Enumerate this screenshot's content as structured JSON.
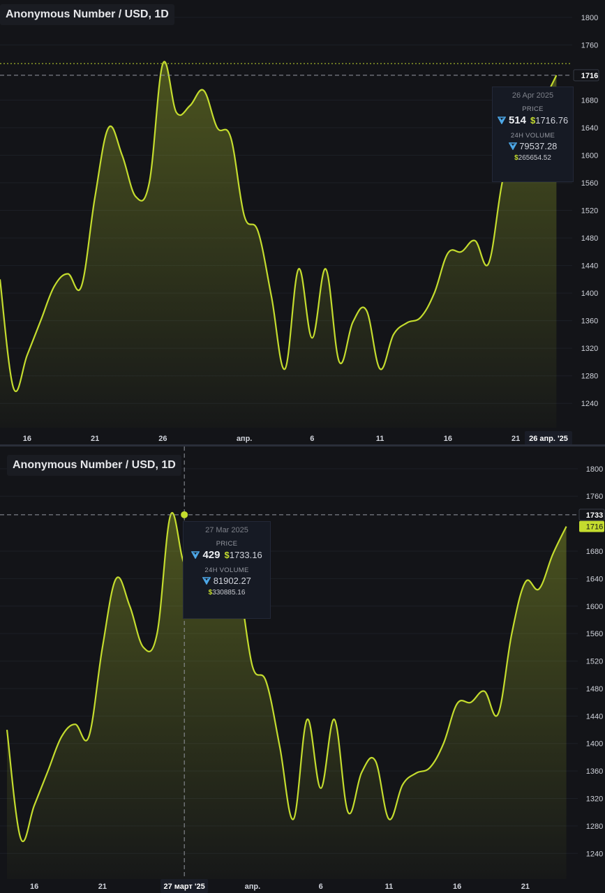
{
  "colors": {
    "background": "#131418",
    "line": "#c4dc2e",
    "grid": "#1c1f26",
    "axis_text": "#d1d4dc",
    "crosshair": "#9598a1",
    "ton": "#4da8e8",
    "price_label_bg": "#c4dc2e"
  },
  "icons": {
    "ton": "ton-diamond-icon"
  },
  "chart_data": [
    {
      "type": "area",
      "title": "Anonymous Number / USD, 1D",
      "x": [
        "Mar 14",
        "Mar 15",
        "Mar 16",
        "Mar 17",
        "Mar 18",
        "Mar 19",
        "Mar 20",
        "Mar 21",
        "Mar 22",
        "Mar 23",
        "Mar 24",
        "Mar 25",
        "Mar 26",
        "Mar 27",
        "Mar 28",
        "Mar 29",
        "Mar 30",
        "Mar 31",
        "Apr 1",
        "Apr 2",
        "Apr 3",
        "Apr 4",
        "Apr 5",
        "Apr 6",
        "Apr 7",
        "Apr 8",
        "Apr 9",
        "Apr 10",
        "Apr 11",
        "Apr 12",
        "Apr 13",
        "Apr 14",
        "Apr 15",
        "Apr 16",
        "Apr 17",
        "Apr 18",
        "Apr 19",
        "Apr 20",
        "Apr 21",
        "Apr 22",
        "Apr 23",
        "Apr 24",
        "Apr 25",
        "Apr 26"
      ],
      "series": [
        {
          "values": [
            1420,
            1262,
            1310,
            1360,
            1410,
            1428,
            1410,
            1540,
            1640,
            1600,
            1540,
            1560,
            1733,
            1662,
            1672,
            1694,
            1640,
            1626,
            1512,
            1490,
            1395,
            1290,
            1435,
            1335,
            1435,
            1300,
            1358,
            1375,
            1290,
            1340,
            1357,
            1365,
            1400,
            1458,
            1460,
            1476,
            1443,
            1560,
            1635,
            1625,
            1675,
            1716
          ]
        }
      ],
      "ylim": [
        1220,
        1810
      ],
      "y_ticks": [
        "1800",
        "1760",
        "1680",
        "1640",
        "1600",
        "1560",
        "1520",
        "1480",
        "1440",
        "1400",
        "1360",
        "1320",
        "1280",
        "1240"
      ],
      "x_ticks": [
        {
          "label": "16",
          "x": "Mar 16"
        },
        {
          "label": "21",
          "x": "Mar 21"
        },
        {
          "label": "26",
          "x": "Mar 26"
        },
        {
          "label": "апр.",
          "x": "Apr 1"
        },
        {
          "label": "6",
          "x": "Apr 6"
        },
        {
          "label": "11",
          "x": "Apr 11"
        },
        {
          "label": "16",
          "x": "Apr 16"
        },
        {
          "label": "21",
          "x": "Apr 21"
        }
      ],
      "crosshair": {
        "x": "Apr 26",
        "y": 1716,
        "y_label": "1716",
        "x_label": "26 апр. '25"
      },
      "last_price_line": 1733,
      "tooltip": {
        "date": "26 Apr 2025",
        "price_label": "PRICE",
        "price_ton": "514",
        "price_usd": "1716.76",
        "volume_label": "24H VOLUME",
        "volume_ton": "79537.28",
        "volume_usd": "265654.52"
      },
      "grid": true
    },
    {
      "type": "area",
      "title": "Anonymous Number / USD, 1D",
      "x": [
        "Mar 14",
        "Mar 15",
        "Mar 16",
        "Mar 17",
        "Mar 18",
        "Mar 19",
        "Mar 20",
        "Mar 21",
        "Mar 22",
        "Mar 23",
        "Mar 24",
        "Mar 25",
        "Mar 26",
        "Mar 27",
        "Mar 28",
        "Mar 29",
        "Mar 30",
        "Mar 31",
        "Apr 1",
        "Apr 2",
        "Apr 3",
        "Apr 4",
        "Apr 5",
        "Apr 6",
        "Apr 7",
        "Apr 8",
        "Apr 9",
        "Apr 10",
        "Apr 11",
        "Apr 12",
        "Apr 13",
        "Apr 14",
        "Apr 15",
        "Apr 16",
        "Apr 17",
        "Apr 18",
        "Apr 19",
        "Apr 20",
        "Apr 21",
        "Apr 22",
        "Apr 23",
        "Apr 24",
        "Apr 25",
        "Apr 26"
      ],
      "series": [
        {
          "values": [
            1420,
            1262,
            1310,
            1360,
            1410,
            1428,
            1410,
            1540,
            1640,
            1600,
            1540,
            1560,
            1733,
            1662,
            1672,
            1694,
            1640,
            1626,
            1512,
            1490,
            1395,
            1290,
            1435,
            1335,
            1435,
            1300,
            1358,
            1375,
            1290,
            1340,
            1357,
            1365,
            1400,
            1458,
            1460,
            1476,
            1443,
            1560,
            1635,
            1625,
            1675,
            1716
          ]
        }
      ],
      "ylim": [
        1220,
        1810
      ],
      "y_ticks": [
        "1800",
        "1760",
        "1680",
        "1640",
        "1600",
        "1560",
        "1520",
        "1480",
        "1440",
        "1400",
        "1360",
        "1320",
        "1280",
        "1240"
      ],
      "x_ticks": [
        {
          "label": "16",
          "x": "Mar 16"
        },
        {
          "label": "21",
          "x": "Mar 21"
        },
        {
          "label": "апр.",
          "x": "Apr 1"
        },
        {
          "label": "6",
          "x": "Apr 6"
        },
        {
          "label": "11",
          "x": "Apr 11"
        },
        {
          "label": "16",
          "x": "Apr 16"
        },
        {
          "label": "21",
          "x": "Apr 21"
        }
      ],
      "crosshair": {
        "x": "Mar 27",
        "y": 1733,
        "y_label": "1733",
        "x_label": "27 март '25"
      },
      "current_price_label": "1716",
      "tooltip": {
        "date": "27 Mar 2025",
        "price_label": "PRICE",
        "price_ton": "429",
        "price_usd": "1733.16",
        "volume_label": "24H VOLUME",
        "volume_ton": "81902.27",
        "volume_usd": "330885.16"
      },
      "grid": true
    }
  ]
}
